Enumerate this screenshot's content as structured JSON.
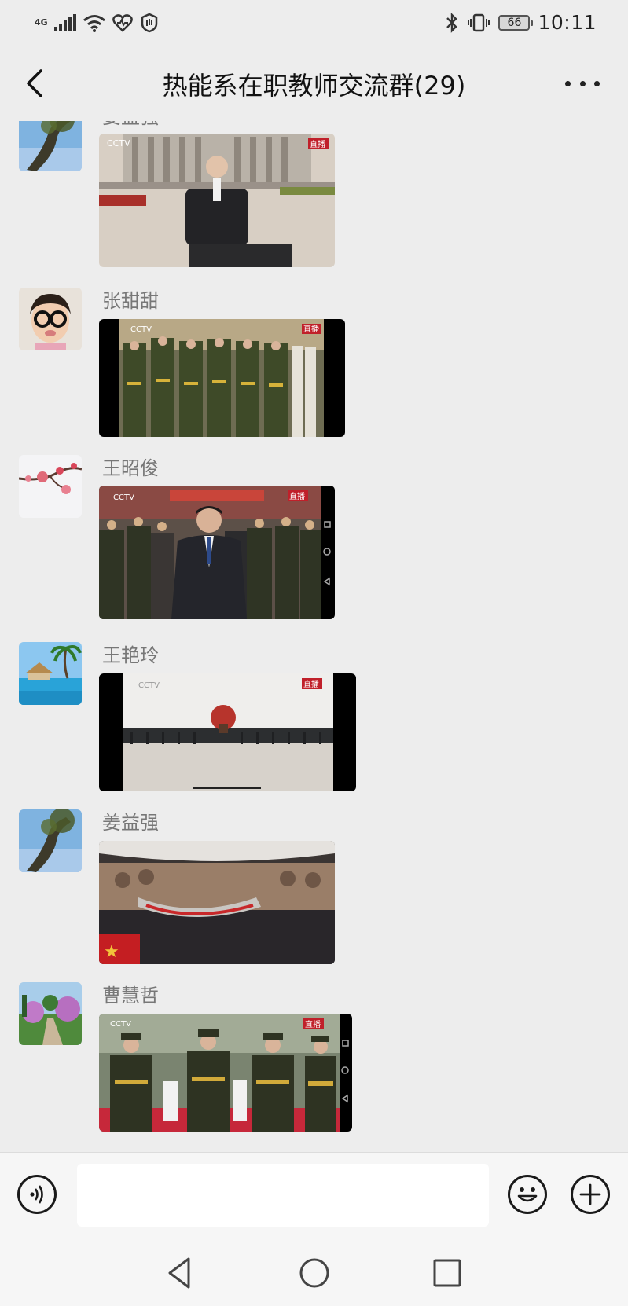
{
  "status_bar": {
    "network": "4G",
    "battery": "66",
    "time": "10:11"
  },
  "header": {
    "title": "热能系在职教师交流群(29)"
  },
  "messages": [
    {
      "sender": "姜益强",
      "type": "video"
    },
    {
      "sender": "张甜甜",
      "type": "video"
    },
    {
      "sender": "王昭俊",
      "type": "video"
    },
    {
      "sender": "王艳玲",
      "type": "video"
    },
    {
      "sender": "姜益强",
      "type": "video"
    },
    {
      "sender": "曹慧哲",
      "type": "video"
    }
  ],
  "video_badges": {
    "live": "直播",
    "channel": "CCTV"
  },
  "input": {
    "value": "",
    "placeholder": ""
  },
  "icons": [
    "back-arrow-icon",
    "more-dots-icon",
    "voice-icon",
    "emoji-icon",
    "plus-icon",
    "nav-back-icon",
    "nav-home-icon",
    "nav-recents-icon"
  ]
}
